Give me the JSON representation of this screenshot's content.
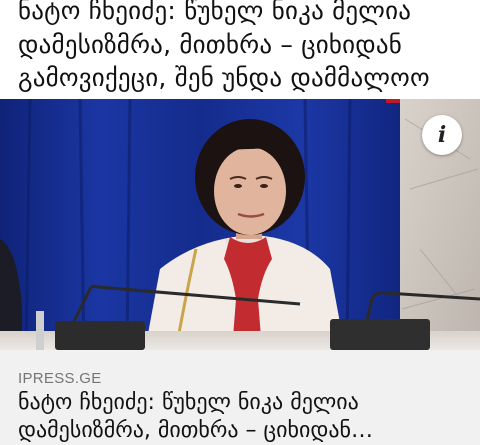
{
  "article": {
    "headline": "ნატო ჩხეიძე: წუხელ ნიკა მელია დამესიზმრა, მითხრა – ციხიდან გამოვიქეცი, შენ უნდა დამმალოო",
    "source": "IPRESS.GE"
  },
  "info_button": {
    "icon": "info-icon",
    "glyph": "i"
  },
  "colors": {
    "footer_bg": "#f1f1f1",
    "source_text": "#757575",
    "photo_backdrop": "#132a8a"
  }
}
